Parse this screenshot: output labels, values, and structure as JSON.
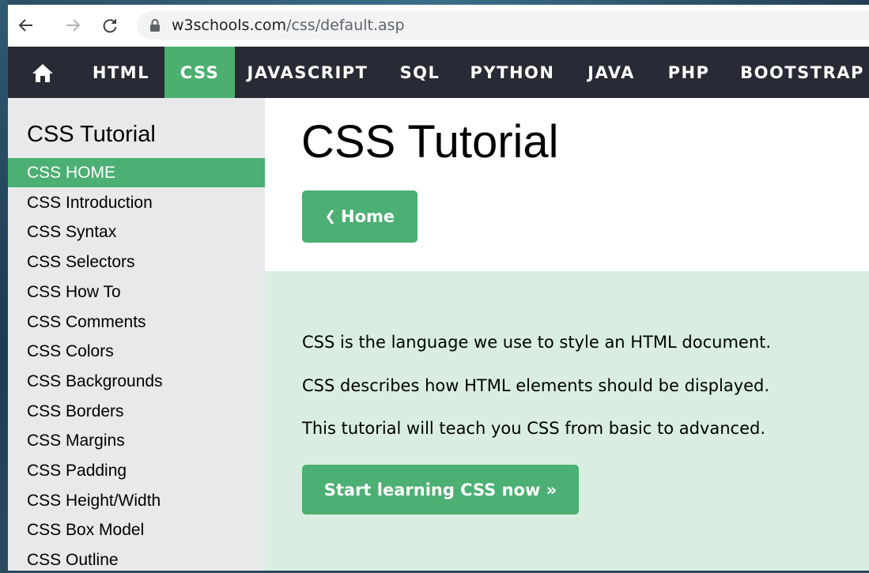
{
  "browser": {
    "url_domain": "w3schools.com",
    "url_path": "/css/default.asp"
  },
  "topnav": {
    "home_icon": "home-icon",
    "items": [
      "HTML",
      "CSS",
      "JAVASCRIPT",
      "SQL",
      "PYTHON",
      "JAVA",
      "PHP",
      "BOOTSTRAP"
    ],
    "active": "CSS"
  },
  "sidebar": {
    "title": "CSS Tutorial",
    "items": [
      "CSS HOME",
      "CSS Introduction",
      "CSS Syntax",
      "CSS Selectors",
      "CSS How To",
      "CSS Comments",
      "CSS Colors",
      "CSS Backgrounds",
      "CSS Borders",
      "CSS Margins",
      "CSS Padding",
      "CSS Height/Width",
      "CSS Box Model",
      "CSS Outline"
    ],
    "active": "CSS HOME"
  },
  "main": {
    "title": "CSS Tutorial",
    "home_button": "Home",
    "intro": [
      "CSS is the language we use to style an HTML document.",
      "CSS describes how HTML elements should be displayed.",
      "This tutorial will teach you CSS from basic to advanced."
    ],
    "start_button": "Start learning CSS now »"
  },
  "colors": {
    "accent_green": "#4caf73",
    "nav_dark": "#282a35",
    "sidebar_bg": "#e7e9eb",
    "intro_bg": "#d9eee1"
  }
}
